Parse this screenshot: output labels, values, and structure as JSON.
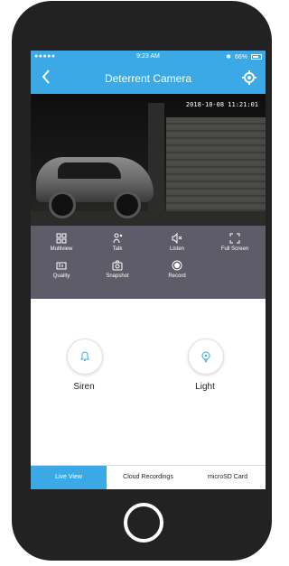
{
  "statusbar": {
    "signal": "●●●●● ",
    "time": "9:23 AM",
    "bluetooth": "✱",
    "battery": "66%"
  },
  "navbar": {
    "title": "Deterrent Camera",
    "back_icon": "chevron-left-icon",
    "settings_icon": "gear-icon"
  },
  "video": {
    "timestamp": "2018-10-08 11:21:01"
  },
  "controls": {
    "multiview": "Multiview",
    "talk": "Talk",
    "listen": "Listen",
    "fullscreen": "Full Screen",
    "quality": "Quality",
    "snapshot": "Snapshot",
    "record": "Record"
  },
  "actions": {
    "siren": "Siren",
    "light": "Light"
  },
  "tabs": {
    "live_view": "Live View",
    "cloud": "Cloud Recordings",
    "microsd": "microSD Card"
  },
  "colors": {
    "accent": "#3aa9e6",
    "controls_bg": "#5f5c69",
    "phone_frame": "#222222"
  }
}
